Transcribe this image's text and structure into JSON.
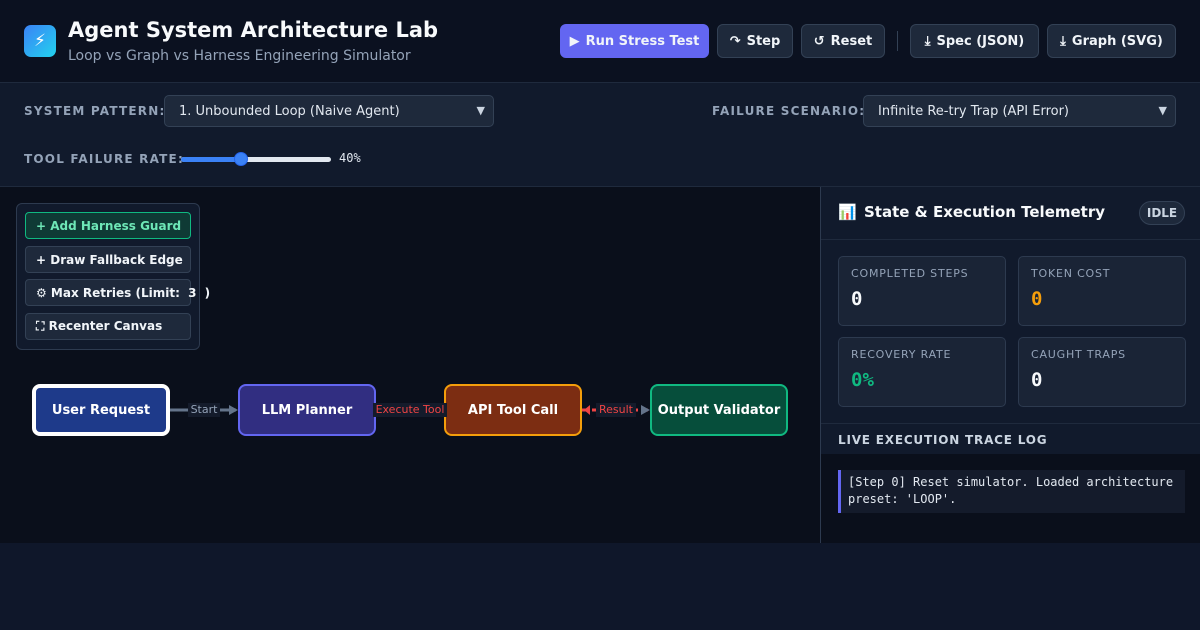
{
  "header": {
    "logo_glyph": "⚡",
    "title": "Agent System Architecture Lab",
    "subtitle": "Loop vs Graph vs Harness Engineering Simulator",
    "buttons": {
      "run": {
        "icon": "▶",
        "label": "Run Stress Test"
      },
      "step": {
        "icon": "↷",
        "label": "Step"
      },
      "reset": {
        "icon": "↺",
        "label": "Reset"
      },
      "spec": {
        "icon": "⤓",
        "label": "Spec (JSON)"
      },
      "graph": {
        "icon": "⤓",
        "label": "Graph (SVG)"
      }
    }
  },
  "controls": {
    "pattern_label": "SYSTEM PATTERN:",
    "pattern_value": "1. Unbounded Loop (Naive Agent)",
    "scenario_label": "FAILURE SCENARIO:",
    "scenario_value": "Infinite Re-try Trap (API Error)",
    "rate_label": "TOOL FAILURE RATE:",
    "rate_percent": 40,
    "rate_text": "40%"
  },
  "toolbox": {
    "add_harness": "+ Add Harness Guard",
    "draw_fallback": "+ Draw Fallback Edge",
    "max_retries_prefix": "⚙ Max Retries (Limit:",
    "max_retries_value": "3",
    "max_retries_suffix": ")",
    "recenter": "⛶ Recenter Canvas"
  },
  "graph": {
    "nodes": [
      {
        "label": "User Request",
        "fill": "#1e3a8a",
        "border": "#ffffff"
      },
      {
        "label": "LLM Planner",
        "fill": "#312e81",
        "border": "#6366f1"
      },
      {
        "label": "API Tool Call",
        "fill": "#7c2d12",
        "border": "#f59e0b"
      },
      {
        "label": "Output Validator",
        "fill": "#064e3b",
        "border": "#10b981"
      }
    ],
    "edges": [
      {
        "label": "Start",
        "color": "#64748b",
        "dashed": false
      },
      {
        "label": "Execute Tool",
        "color": "#ef4444",
        "dashed": true
      },
      {
        "label": "Result",
        "color": "#ef4444",
        "dashed": true
      }
    ]
  },
  "telemetry": {
    "icon": "📊",
    "title": "State & Execution Telemetry",
    "status": "IDLE",
    "metrics": [
      {
        "label": "COMPLETED STEPS",
        "value": "0",
        "color": "#f8fafc"
      },
      {
        "label": "TOKEN COST",
        "value": "0",
        "color": "#f59e0b"
      },
      {
        "label": "RECOVERY RATE",
        "value": "0%",
        "color": "#10b981"
      },
      {
        "label": "CAUGHT TRAPS",
        "value": "0",
        "color": "#f8fafc"
      }
    ],
    "log_title": "LIVE EXECUTION TRACE LOG",
    "log_entries": [
      "[Step 0] Reset simulator. Loaded architecture preset: 'LOOP'."
    ]
  }
}
